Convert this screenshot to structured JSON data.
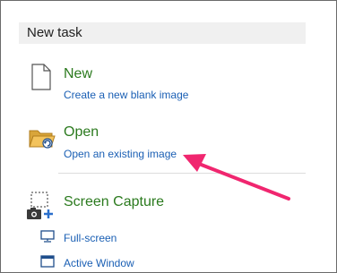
{
  "panel": {
    "header": "New task",
    "tasks": {
      "new": {
        "title": "New",
        "link": "Create a new blank image",
        "icon": "blank-page-icon"
      },
      "open": {
        "title": "Open",
        "link": "Open an existing image",
        "icon": "open-folder-icon"
      },
      "capture": {
        "title": "Screen Capture",
        "icon": "screen-capture-icon"
      }
    },
    "capture_options": [
      {
        "label": "Full-screen",
        "icon": "monitor-icon"
      },
      {
        "label": "Active Window",
        "icon": "window-icon"
      }
    ]
  },
  "annotation": {
    "arrow_color": "#f0266f"
  },
  "colors": {
    "title_green": "#2b7a1e",
    "link_blue": "#1a5fb4",
    "header_bg": "#f0f0f0"
  }
}
